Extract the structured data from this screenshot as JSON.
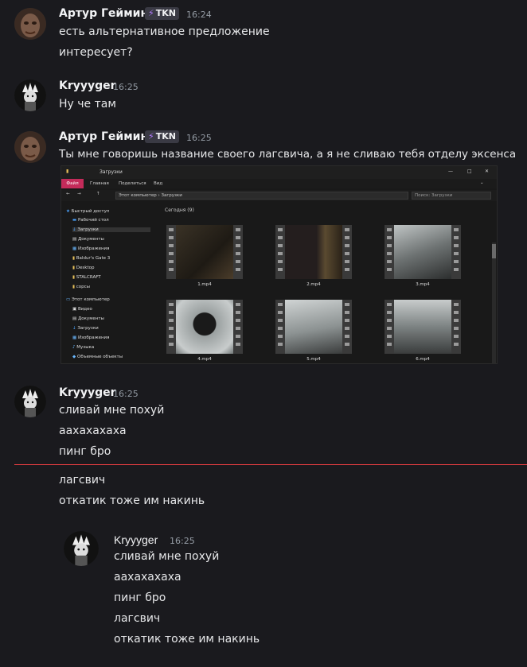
{
  "messages": [
    {
      "author": "Артур Гейминг",
      "tag": "TKN",
      "time": "16:24",
      "lines": [
        "есть альтернативное предложение",
        "интересует?"
      ]
    },
    {
      "author": "Kryyyger",
      "time": "16:25",
      "lines": [
        "Ну че там"
      ]
    },
    {
      "author": "Артур Гейминг",
      "tag": "TKN",
      "time": "16:25",
      "lines": [
        "Ты мне говоришь название своего лагсвича, а я не сливаю тебя отделу эксенса"
      ]
    },
    {
      "author": "Kryyyger",
      "time": "16:25",
      "lines": [
        "сливай мне похуй",
        "аахахахаха",
        "пинг бро"
      ]
    },
    {
      "lines": [
        "лагсвич",
        "откатик тоже им накинь"
      ]
    }
  ],
  "quoted": {
    "author": "Kryyyger",
    "time": "16:25",
    "lines": [
      "сливай мне похуй",
      "аахахахаха",
      "пинг бро",
      "лагсвич",
      "откатик тоже им накинь"
    ]
  },
  "explorer": {
    "title": "Загрузки",
    "ribbon": [
      "Файл",
      "Главная",
      "Поделиться",
      "Вид"
    ],
    "path": [
      "Этот компьютер",
      "Загрузки"
    ],
    "search_placeholder": "Поиск: Загрузки",
    "nav": [
      "Быстрый доступ",
      "Рабочий стол",
      "Загрузки",
      "Документы",
      "Изображения",
      "Baldur's Gate 3",
      "Desktop",
      "STALCRAFT",
      "сорсы",
      "Этот компьютер",
      "Видео",
      "Документы",
      "Загрузки",
      "Изображения",
      "Музыка",
      "Объемные объекты"
    ],
    "group": "Сегодня (9)",
    "files": [
      "1.mp4",
      "2.mp4",
      "3.mp4",
      "4.mp4",
      "5.mp4",
      "6.mp4"
    ]
  },
  "colors": {
    "tag_bolt": "#b57cff",
    "new_divider": "#f23f43",
    "file_tab": "#c42b5a"
  }
}
